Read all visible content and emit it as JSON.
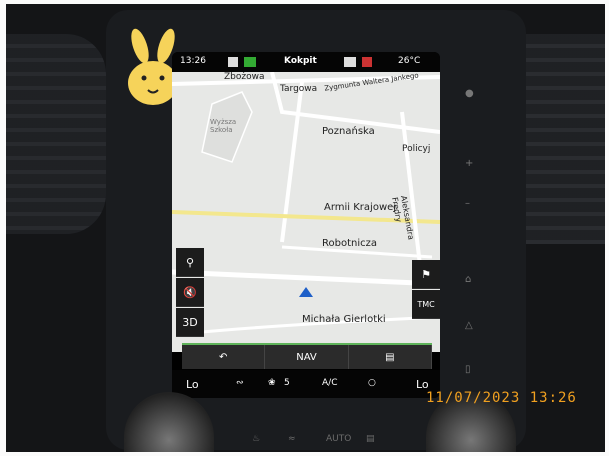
{
  "status_bar": {
    "time": "13:26",
    "title": "Kokpit",
    "temperature": "26°C"
  },
  "map": {
    "streets": [
      "Zbożowa",
      "Targowa",
      "Zygmunta Waltera Jankego",
      "Poznańska",
      "Policyj",
      "Armii Krajowej",
      "Aleksandra Fredry",
      "Robotnicza",
      "Michała Gierlotki"
    ],
    "poi_label": "Wyższa Szkoła"
  },
  "map_controls": {
    "search_icon": "search-icon",
    "mute_icon": "mute-icon",
    "view_label": "3D"
  },
  "right_controls": {
    "destination_icon": "flag-icon",
    "tmc_label": "TMC"
  },
  "bottom_bar": {
    "back_icon": "back-icon",
    "nav_label": "NAV",
    "menu_icon": "menu-icon"
  },
  "climate": {
    "left_temp": "Lo",
    "fan_speed": "5",
    "ac_label": "A/C",
    "right_temp": "Lo"
  },
  "console": {
    "auto_label": "AUTO"
  },
  "timestamp": "11/07/2023  13:26",
  "colors": {
    "accent": "#5fb35a",
    "timestamp": "#f0a020",
    "bunny": "#f6d35a",
    "map_bg": "#e7e8e6",
    "position_arrow": "#1e5fc8"
  }
}
